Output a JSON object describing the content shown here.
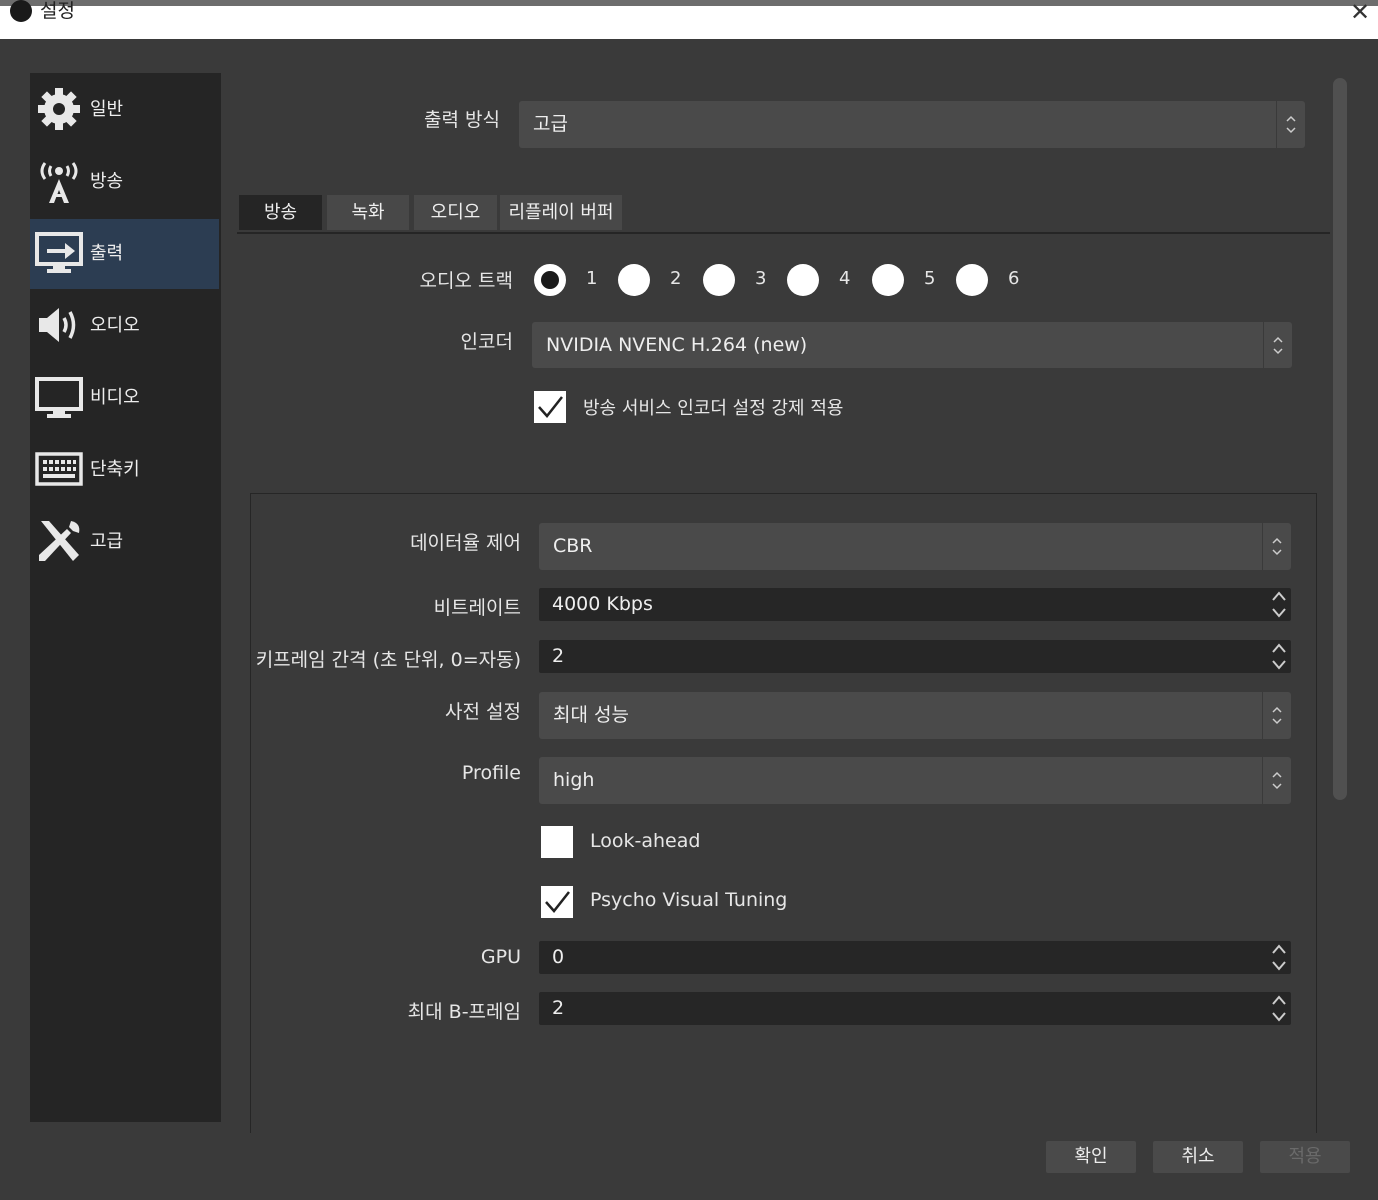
{
  "window": {
    "title": "설정"
  },
  "sidebar": {
    "items": [
      {
        "label": "일반",
        "icon": "gear-icon"
      },
      {
        "label": "방송",
        "icon": "broadcast-antenna-icon"
      },
      {
        "label": "출력",
        "icon": "output-monitor-icon"
      },
      {
        "label": "오디오",
        "icon": "speaker-icon"
      },
      {
        "label": "비디오",
        "icon": "monitor-icon"
      },
      {
        "label": "단축키",
        "icon": "keyboard-icon"
      },
      {
        "label": "고급",
        "icon": "tools-icon"
      }
    ],
    "active_index": 2
  },
  "output_mode": {
    "label": "출력 방식",
    "value": "고급"
  },
  "tabs": [
    {
      "label": "방송"
    },
    {
      "label": "녹화"
    },
    {
      "label": "오디오"
    },
    {
      "label": "리플레이 버퍼"
    }
  ],
  "audio_track": {
    "label": "오디오 트랙",
    "options": [
      "1",
      "2",
      "3",
      "4",
      "5",
      "6"
    ],
    "selected": "1"
  },
  "encoder": {
    "label": "인코더",
    "value": "NVIDIA NVENC H.264 (new)"
  },
  "enforce_checkbox": {
    "label": "방송 서비스 인코더 설정 강제 적용",
    "checked": true
  },
  "rate_control": {
    "label": "데이터율 제어",
    "value": "CBR"
  },
  "bitrate": {
    "label": "비트레이트",
    "value": "4000 Kbps"
  },
  "keyframe": {
    "label": "키프레임 간격 (초 단위, 0=자동)",
    "value": "2"
  },
  "preset": {
    "label": "사전 설정",
    "value": "최대 성능"
  },
  "profile": {
    "label": "Profile",
    "value": "high"
  },
  "look_ahead": {
    "label": "Look-ahead",
    "checked": false
  },
  "psycho_visual": {
    "label": "Psycho Visual Tuning",
    "checked": true
  },
  "gpu": {
    "label": "GPU",
    "value": "0"
  },
  "max_bframes": {
    "label": "최대 B-프레임",
    "value": "2"
  },
  "buttons": {
    "ok": "확인",
    "cancel": "취소",
    "apply": "적용"
  },
  "colors": {
    "active_sidebar": "#2c3d52",
    "background": "#3a3a3a",
    "panel": "#252525"
  }
}
